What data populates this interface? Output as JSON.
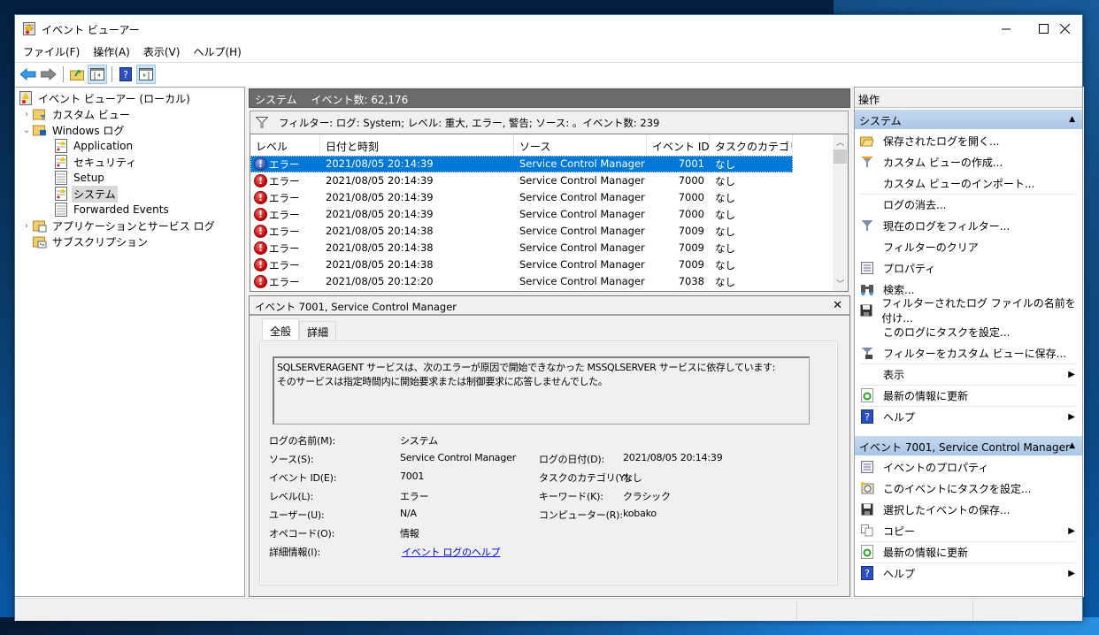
{
  "window": {
    "title": "イベント ビューアー",
    "controls": {
      "minimize": "─",
      "maximize": "☐",
      "close": "✕"
    }
  },
  "menu": [
    "ファイル(F)",
    "操作(A)",
    "表示(V)",
    "ヘルプ(H)"
  ],
  "toolbar": {
    "buttons": [
      "back-icon",
      "forward-icon",
      "up-folder-icon",
      "show-hide-tree-icon",
      "help-icon",
      "show-hide-actions-icon"
    ]
  },
  "tree": {
    "root": "イベント ビューアー (ローカル)",
    "items": [
      {
        "label": "カスタム ビュー",
        "expander": "›"
      },
      {
        "label": "Windows ログ",
        "expander": "⌄"
      },
      {
        "label": "Application"
      },
      {
        "label": "セキュリティ"
      },
      {
        "label": "Setup"
      },
      {
        "label": "システム",
        "selected": true
      },
      {
        "label": "Forwarded Events"
      },
      {
        "label": "アプリケーションとサービス ログ",
        "expander": "›"
      },
      {
        "label": "サブスクリプション"
      }
    ]
  },
  "center": {
    "header_name": "システム",
    "header_count": "イベント数: 62,176",
    "filter_text": "フィルター: ログ: System; レベル: 重大, エラー, 警告; ソース: 。イベント数: 239",
    "columns": [
      "レベル",
      "日付と時刻",
      "ソース",
      "イベント ID",
      "タスクのカテゴリ"
    ],
    "rows": [
      {
        "level": "エラー",
        "datetime": "2021/08/05 20:14:39",
        "source": "Service Control Manager",
        "event_id": "7001",
        "category": "なし",
        "selected": true
      },
      {
        "level": "エラー",
        "datetime": "2021/08/05 20:14:39",
        "source": "Service Control Manager",
        "event_id": "7000",
        "category": "なし"
      },
      {
        "level": "エラー",
        "datetime": "2021/08/05 20:14:39",
        "source": "Service Control Manager",
        "event_id": "7000",
        "category": "なし"
      },
      {
        "level": "エラー",
        "datetime": "2021/08/05 20:14:39",
        "source": "Service Control Manager",
        "event_id": "7000",
        "category": "なし"
      },
      {
        "level": "エラー",
        "datetime": "2021/08/05 20:14:38",
        "source": "Service Control Manager",
        "event_id": "7009",
        "category": "なし"
      },
      {
        "level": "エラー",
        "datetime": "2021/08/05 20:14:38",
        "source": "Service Control Manager",
        "event_id": "7009",
        "category": "なし"
      },
      {
        "level": "エラー",
        "datetime": "2021/08/05 20:14:38",
        "source": "Service Control Manager",
        "event_id": "7009",
        "category": "なし"
      },
      {
        "level": "エラー",
        "datetime": "2021/08/05 20:12:20",
        "source": "Service Control Manager",
        "event_id": "7038",
        "category": "なし"
      }
    ]
  },
  "detail": {
    "title": "イベント 7001, Service Control Manager",
    "close": "✕",
    "tabs": [
      "全般",
      "詳細"
    ],
    "message_line1": "SQLSERVERAGENT サービスは、次のエラーが原因で開始できなかった MSSQLSERVER サービスに依存しています:",
    "message_line2": "そのサービスは指定時間内に開始要求または制御要求に応答しませんでした。",
    "fields": {
      "log_name_label": "ログの名前(M):",
      "log_name": "システム",
      "source_label": "ソース(S):",
      "source": "Service Control Manager",
      "logged_label": "ログの日付(D):",
      "logged": "2021/08/05 20:14:39",
      "event_id_label": "イベント ID(E):",
      "event_id": "7001",
      "task_label": "タスクのカテゴリ(Y):",
      "task": "なし",
      "level_label": "レベル(L):",
      "level": "エラー",
      "keywords_label": "キーワード(K):",
      "keywords": "クラシック",
      "user_label": "ユーザー(U):",
      "user": "N/A",
      "computer_label": "コンピューター(R):",
      "computer": "kobako",
      "opcode_label": "オペコード(O):",
      "opcode": "情報",
      "more_info_label": "詳細情報(I):",
      "more_info_link": "イベント ログのヘルプ"
    }
  },
  "actions": {
    "title": "操作",
    "group1": {
      "title": "システム",
      "items": [
        "保存されたログを開く...",
        "カスタム ビューの作成...",
        "カスタム ビューのインポート...",
        "ログの消去...",
        "現在のログをフィルター...",
        "フィルターのクリア",
        "プロパティ",
        "検索...",
        "フィルターされたログ ファイルの名前を付け...",
        "このログにタスクを設定...",
        "フィルターをカスタム ビューに保存...",
        "表示",
        "最新の情報に更新",
        "ヘルプ"
      ]
    },
    "group2": {
      "title": "イベント 7001, Service Control Manager",
      "items": [
        "イベントのプロパティ",
        "このイベントにタスクを設定...",
        "選択したイベントの保存...",
        "コピー",
        "最新の情報に更新",
        "ヘルプ"
      ]
    },
    "submenu_arrow": "▶",
    "collapse_arrow": "▲"
  }
}
